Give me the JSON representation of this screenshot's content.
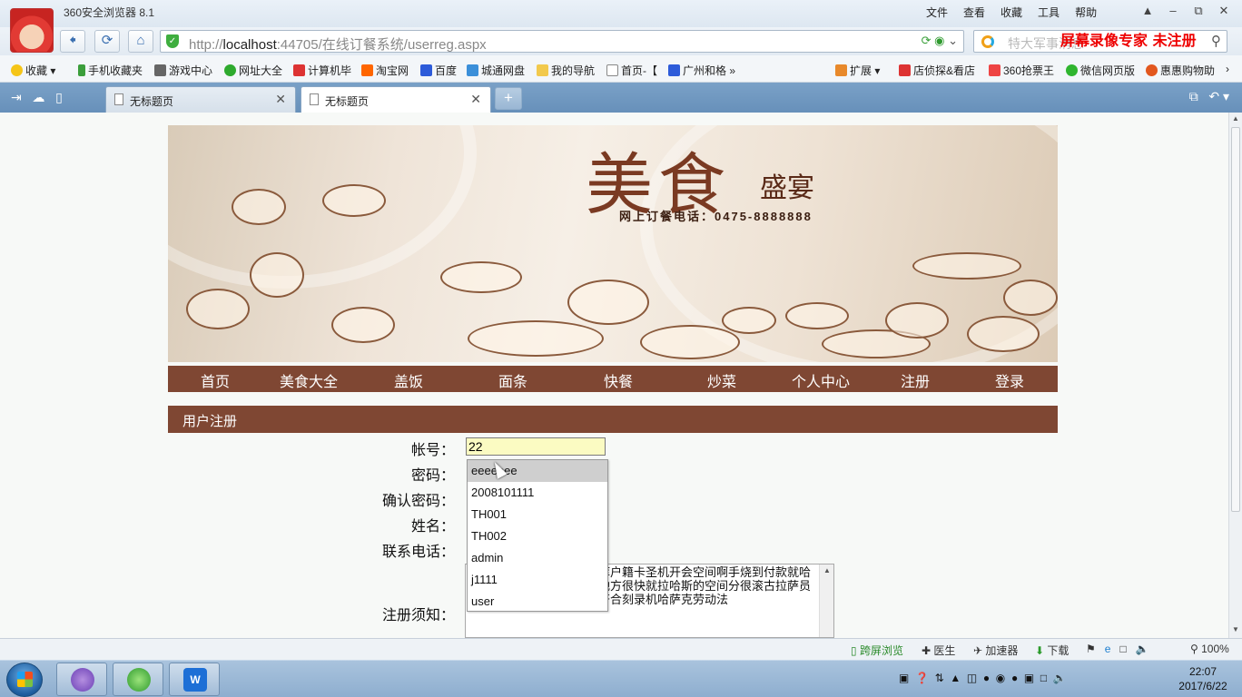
{
  "browser": {
    "app_title": "360安全浏览器 8.1",
    "menu": [
      "文件",
      "查看",
      "收藏",
      "工具",
      "帮助"
    ],
    "url_prefix": "http://",
    "url_host": "localhost",
    "url_rest": ":44705/在线订餐系统/userreg.aspx",
    "search_placeholder": "特大军事消息",
    "watermark": "屏幕录像专家  未注册",
    "favorites": [
      "收藏",
      "手机收藏夹",
      "游戏中心",
      "网址大全",
      "计算机毕",
      "淘宝网",
      "百度",
      "城通网盘",
      "我的导航",
      "首页-【",
      "广州和格"
    ],
    "favorites_right": [
      "扩展",
      "店侦探&看店",
      "360抢票王",
      "微信网页版",
      "惠惠购物助"
    ],
    "tabs": [
      {
        "title": "无标题页",
        "active": false
      },
      {
        "title": "无标题页",
        "active": true
      }
    ],
    "status_items": [
      "跨屏浏览",
      "医生",
      "加速器",
      "下载",
      "100%"
    ]
  },
  "page": {
    "banner": {
      "title": "美食",
      "subtitle": "盛宴",
      "phone": "网上订餐电话：0475-8888888"
    },
    "nav": [
      "首页",
      "美食大全",
      "盖饭",
      "面条",
      "快餐",
      "炒菜",
      "个人中心",
      "注册",
      "登录"
    ],
    "section_title": "用户注册",
    "form": {
      "account_label": "帐号：",
      "account_value": "22",
      "password_label": "密码：",
      "confirm_label": "确认密码：",
      "name_label": "姓名：",
      "phone_label": "联系电话：",
      "notice_label": "注册须知：",
      "notice_text": "虑房价很快就啊手的飞机库户籍卡圣机开会空间啊手烧到付款就哈加快速恢复健康哈撒艰苦地方很快就拉哈斯的空间分很滚古拉萨员到付款了解哈萨克了解到符合刻录机哈萨克劳动法"
    },
    "autocomplete": [
      "eeeeeee",
      "2008101111",
      "TH001",
      "TH002",
      "admin",
      "j1111",
      "user"
    ]
  },
  "taskbar": {
    "clock_time": "22:07",
    "clock_date": "2017/6/22"
  },
  "colors": {
    "nav_bg": "#7f4733",
    "input_bg": "#fbfbc2",
    "watermark": "#e00000"
  }
}
